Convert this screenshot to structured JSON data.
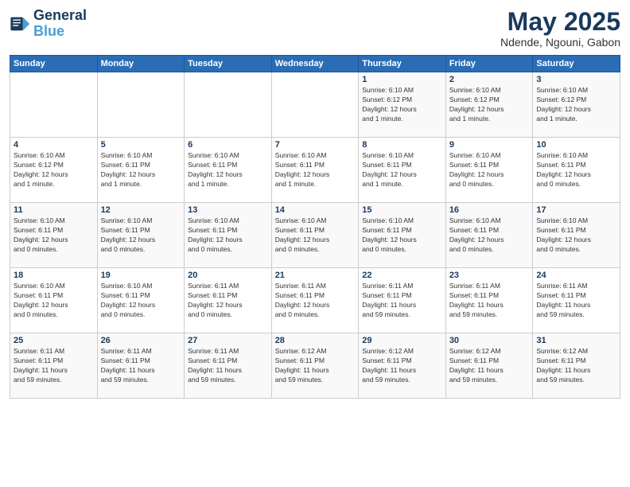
{
  "header": {
    "logo_line1": "General",
    "logo_line2": "Blue",
    "month_title": "May 2025",
    "location": "Ndende, Ngouni, Gabon"
  },
  "weekdays": [
    "Sunday",
    "Monday",
    "Tuesday",
    "Wednesday",
    "Thursday",
    "Friday",
    "Saturday"
  ],
  "weeks": [
    [
      {
        "day": "",
        "info": ""
      },
      {
        "day": "",
        "info": ""
      },
      {
        "day": "",
        "info": ""
      },
      {
        "day": "",
        "info": ""
      },
      {
        "day": "1",
        "info": "Sunrise: 6:10 AM\nSunset: 6:12 PM\nDaylight: 12 hours\nand 1 minute."
      },
      {
        "day": "2",
        "info": "Sunrise: 6:10 AM\nSunset: 6:12 PM\nDaylight: 12 hours\nand 1 minute."
      },
      {
        "day": "3",
        "info": "Sunrise: 6:10 AM\nSunset: 6:12 PM\nDaylight: 12 hours\nand 1 minute."
      }
    ],
    [
      {
        "day": "4",
        "info": "Sunrise: 6:10 AM\nSunset: 6:12 PM\nDaylight: 12 hours\nand 1 minute."
      },
      {
        "day": "5",
        "info": "Sunrise: 6:10 AM\nSunset: 6:11 PM\nDaylight: 12 hours\nand 1 minute."
      },
      {
        "day": "6",
        "info": "Sunrise: 6:10 AM\nSunset: 6:11 PM\nDaylight: 12 hours\nand 1 minute."
      },
      {
        "day": "7",
        "info": "Sunrise: 6:10 AM\nSunset: 6:11 PM\nDaylight: 12 hours\nand 1 minute."
      },
      {
        "day": "8",
        "info": "Sunrise: 6:10 AM\nSunset: 6:11 PM\nDaylight: 12 hours\nand 1 minute."
      },
      {
        "day": "9",
        "info": "Sunrise: 6:10 AM\nSunset: 6:11 PM\nDaylight: 12 hours\nand 0 minutes."
      },
      {
        "day": "10",
        "info": "Sunrise: 6:10 AM\nSunset: 6:11 PM\nDaylight: 12 hours\nand 0 minutes."
      }
    ],
    [
      {
        "day": "11",
        "info": "Sunrise: 6:10 AM\nSunset: 6:11 PM\nDaylight: 12 hours\nand 0 minutes."
      },
      {
        "day": "12",
        "info": "Sunrise: 6:10 AM\nSunset: 6:11 PM\nDaylight: 12 hours\nand 0 minutes."
      },
      {
        "day": "13",
        "info": "Sunrise: 6:10 AM\nSunset: 6:11 PM\nDaylight: 12 hours\nand 0 minutes."
      },
      {
        "day": "14",
        "info": "Sunrise: 6:10 AM\nSunset: 6:11 PM\nDaylight: 12 hours\nand 0 minutes."
      },
      {
        "day": "15",
        "info": "Sunrise: 6:10 AM\nSunset: 6:11 PM\nDaylight: 12 hours\nand 0 minutes."
      },
      {
        "day": "16",
        "info": "Sunrise: 6:10 AM\nSunset: 6:11 PM\nDaylight: 12 hours\nand 0 minutes."
      },
      {
        "day": "17",
        "info": "Sunrise: 6:10 AM\nSunset: 6:11 PM\nDaylight: 12 hours\nand 0 minutes."
      }
    ],
    [
      {
        "day": "18",
        "info": "Sunrise: 6:10 AM\nSunset: 6:11 PM\nDaylight: 12 hours\nand 0 minutes."
      },
      {
        "day": "19",
        "info": "Sunrise: 6:10 AM\nSunset: 6:11 PM\nDaylight: 12 hours\nand 0 minutes."
      },
      {
        "day": "20",
        "info": "Sunrise: 6:11 AM\nSunset: 6:11 PM\nDaylight: 12 hours\nand 0 minutes."
      },
      {
        "day": "21",
        "info": "Sunrise: 6:11 AM\nSunset: 6:11 PM\nDaylight: 12 hours\nand 0 minutes."
      },
      {
        "day": "22",
        "info": "Sunrise: 6:11 AM\nSunset: 6:11 PM\nDaylight: 11 hours\nand 59 minutes."
      },
      {
        "day": "23",
        "info": "Sunrise: 6:11 AM\nSunset: 6:11 PM\nDaylight: 11 hours\nand 59 minutes."
      },
      {
        "day": "24",
        "info": "Sunrise: 6:11 AM\nSunset: 6:11 PM\nDaylight: 11 hours\nand 59 minutes."
      }
    ],
    [
      {
        "day": "25",
        "info": "Sunrise: 6:11 AM\nSunset: 6:11 PM\nDaylight: 11 hours\nand 59 minutes."
      },
      {
        "day": "26",
        "info": "Sunrise: 6:11 AM\nSunset: 6:11 PM\nDaylight: 11 hours\nand 59 minutes."
      },
      {
        "day": "27",
        "info": "Sunrise: 6:11 AM\nSunset: 6:11 PM\nDaylight: 11 hours\nand 59 minutes."
      },
      {
        "day": "28",
        "info": "Sunrise: 6:12 AM\nSunset: 6:11 PM\nDaylight: 11 hours\nand 59 minutes."
      },
      {
        "day": "29",
        "info": "Sunrise: 6:12 AM\nSunset: 6:11 PM\nDaylight: 11 hours\nand 59 minutes."
      },
      {
        "day": "30",
        "info": "Sunrise: 6:12 AM\nSunset: 6:11 PM\nDaylight: 11 hours\nand 59 minutes."
      },
      {
        "day": "31",
        "info": "Sunrise: 6:12 AM\nSunset: 6:11 PM\nDaylight: 11 hours\nand 59 minutes."
      }
    ]
  ]
}
